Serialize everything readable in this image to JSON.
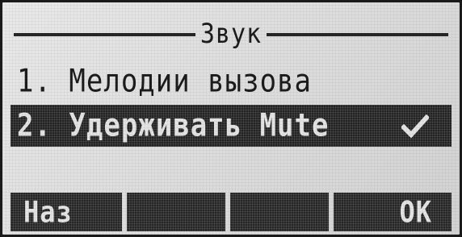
{
  "screen": {
    "title": "Звук"
  },
  "menu": {
    "items": [
      {
        "label": "1. Мелодии вызова",
        "selected": false,
        "checked": false
      },
      {
        "label": "2. Удерживать Mute",
        "selected": true,
        "checked": true,
        "check_icon": "checkmark-icon"
      }
    ]
  },
  "softkeys": {
    "left": "Наз",
    "middle_left": "",
    "middle_right": "",
    "right": "OK"
  },
  "colors": {
    "lcd_background": "#dedede",
    "lcd_foreground": "#1c1c1c",
    "highlight": "#232323"
  }
}
